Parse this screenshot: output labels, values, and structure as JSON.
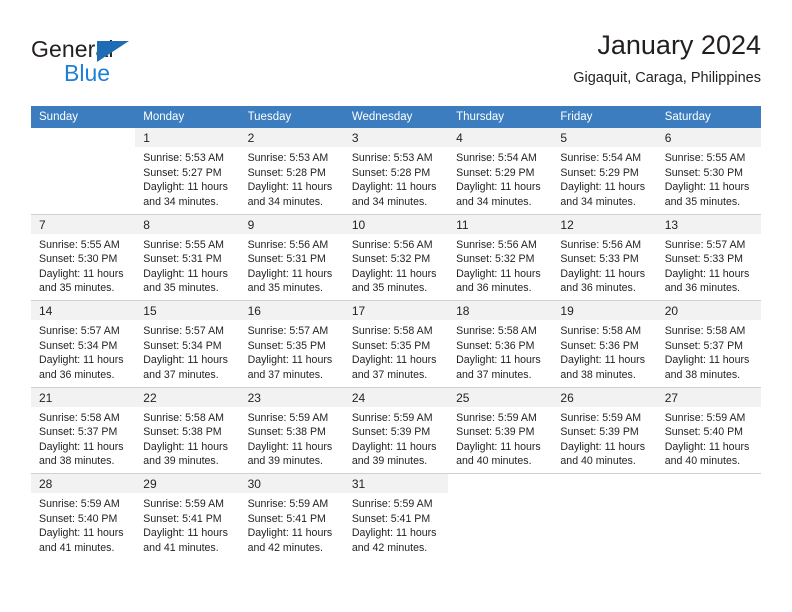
{
  "brand": {
    "name_part1": "General",
    "name_part2": "Blue",
    "triangle_color": "#1e6cb5",
    "blue_color": "#1e7fd4"
  },
  "header": {
    "title": "January 2024",
    "subtitle": "Gigaquit, Caraga, Philippines"
  },
  "theme": {
    "header_row_bg": "#3b7dbf",
    "daynum_bg": "#f2f2f2",
    "text_color": "#231f20",
    "grid_line": "#d9d9d9"
  },
  "weekdays": [
    "Sunday",
    "Monday",
    "Tuesday",
    "Wednesday",
    "Thursday",
    "Friday",
    "Saturday"
  ],
  "weeks": [
    [
      {
        "day": "",
        "sunrise": "",
        "sunset": "",
        "daylight1": "",
        "daylight2": ""
      },
      {
        "day": "1",
        "sunrise": "Sunrise: 5:53 AM",
        "sunset": "Sunset: 5:27 PM",
        "daylight1": "Daylight: 11 hours",
        "daylight2": "and 34 minutes."
      },
      {
        "day": "2",
        "sunrise": "Sunrise: 5:53 AM",
        "sunset": "Sunset: 5:28 PM",
        "daylight1": "Daylight: 11 hours",
        "daylight2": "and 34 minutes."
      },
      {
        "day": "3",
        "sunrise": "Sunrise: 5:53 AM",
        "sunset": "Sunset: 5:28 PM",
        "daylight1": "Daylight: 11 hours",
        "daylight2": "and 34 minutes."
      },
      {
        "day": "4",
        "sunrise": "Sunrise: 5:54 AM",
        "sunset": "Sunset: 5:29 PM",
        "daylight1": "Daylight: 11 hours",
        "daylight2": "and 34 minutes."
      },
      {
        "day": "5",
        "sunrise": "Sunrise: 5:54 AM",
        "sunset": "Sunset: 5:29 PM",
        "daylight1": "Daylight: 11 hours",
        "daylight2": "and 34 minutes."
      },
      {
        "day": "6",
        "sunrise": "Sunrise: 5:55 AM",
        "sunset": "Sunset: 5:30 PM",
        "daylight1": "Daylight: 11 hours",
        "daylight2": "and 35 minutes."
      }
    ],
    [
      {
        "day": "7",
        "sunrise": "Sunrise: 5:55 AM",
        "sunset": "Sunset: 5:30 PM",
        "daylight1": "Daylight: 11 hours",
        "daylight2": "and 35 minutes."
      },
      {
        "day": "8",
        "sunrise": "Sunrise: 5:55 AM",
        "sunset": "Sunset: 5:31 PM",
        "daylight1": "Daylight: 11 hours",
        "daylight2": "and 35 minutes."
      },
      {
        "day": "9",
        "sunrise": "Sunrise: 5:56 AM",
        "sunset": "Sunset: 5:31 PM",
        "daylight1": "Daylight: 11 hours",
        "daylight2": "and 35 minutes."
      },
      {
        "day": "10",
        "sunrise": "Sunrise: 5:56 AM",
        "sunset": "Sunset: 5:32 PM",
        "daylight1": "Daylight: 11 hours",
        "daylight2": "and 35 minutes."
      },
      {
        "day": "11",
        "sunrise": "Sunrise: 5:56 AM",
        "sunset": "Sunset: 5:32 PM",
        "daylight1": "Daylight: 11 hours",
        "daylight2": "and 36 minutes."
      },
      {
        "day": "12",
        "sunrise": "Sunrise: 5:56 AM",
        "sunset": "Sunset: 5:33 PM",
        "daylight1": "Daylight: 11 hours",
        "daylight2": "and 36 minutes."
      },
      {
        "day": "13",
        "sunrise": "Sunrise: 5:57 AM",
        "sunset": "Sunset: 5:33 PM",
        "daylight1": "Daylight: 11 hours",
        "daylight2": "and 36 minutes."
      }
    ],
    [
      {
        "day": "14",
        "sunrise": "Sunrise: 5:57 AM",
        "sunset": "Sunset: 5:34 PM",
        "daylight1": "Daylight: 11 hours",
        "daylight2": "and 36 minutes."
      },
      {
        "day": "15",
        "sunrise": "Sunrise: 5:57 AM",
        "sunset": "Sunset: 5:34 PM",
        "daylight1": "Daylight: 11 hours",
        "daylight2": "and 37 minutes."
      },
      {
        "day": "16",
        "sunrise": "Sunrise: 5:57 AM",
        "sunset": "Sunset: 5:35 PM",
        "daylight1": "Daylight: 11 hours",
        "daylight2": "and 37 minutes."
      },
      {
        "day": "17",
        "sunrise": "Sunrise: 5:58 AM",
        "sunset": "Sunset: 5:35 PM",
        "daylight1": "Daylight: 11 hours",
        "daylight2": "and 37 minutes."
      },
      {
        "day": "18",
        "sunrise": "Sunrise: 5:58 AM",
        "sunset": "Sunset: 5:36 PM",
        "daylight1": "Daylight: 11 hours",
        "daylight2": "and 37 minutes."
      },
      {
        "day": "19",
        "sunrise": "Sunrise: 5:58 AM",
        "sunset": "Sunset: 5:36 PM",
        "daylight1": "Daylight: 11 hours",
        "daylight2": "and 38 minutes."
      },
      {
        "day": "20",
        "sunrise": "Sunrise: 5:58 AM",
        "sunset": "Sunset: 5:37 PM",
        "daylight1": "Daylight: 11 hours",
        "daylight2": "and 38 minutes."
      }
    ],
    [
      {
        "day": "21",
        "sunrise": "Sunrise: 5:58 AM",
        "sunset": "Sunset: 5:37 PM",
        "daylight1": "Daylight: 11 hours",
        "daylight2": "and 38 minutes."
      },
      {
        "day": "22",
        "sunrise": "Sunrise: 5:58 AM",
        "sunset": "Sunset: 5:38 PM",
        "daylight1": "Daylight: 11 hours",
        "daylight2": "and 39 minutes."
      },
      {
        "day": "23",
        "sunrise": "Sunrise: 5:59 AM",
        "sunset": "Sunset: 5:38 PM",
        "daylight1": "Daylight: 11 hours",
        "daylight2": "and 39 minutes."
      },
      {
        "day": "24",
        "sunrise": "Sunrise: 5:59 AM",
        "sunset": "Sunset: 5:39 PM",
        "daylight1": "Daylight: 11 hours",
        "daylight2": "and 39 minutes."
      },
      {
        "day": "25",
        "sunrise": "Sunrise: 5:59 AM",
        "sunset": "Sunset: 5:39 PM",
        "daylight1": "Daylight: 11 hours",
        "daylight2": "and 40 minutes."
      },
      {
        "day": "26",
        "sunrise": "Sunrise: 5:59 AM",
        "sunset": "Sunset: 5:39 PM",
        "daylight1": "Daylight: 11 hours",
        "daylight2": "and 40 minutes."
      },
      {
        "day": "27",
        "sunrise": "Sunrise: 5:59 AM",
        "sunset": "Sunset: 5:40 PM",
        "daylight1": "Daylight: 11 hours",
        "daylight2": "and 40 minutes."
      }
    ],
    [
      {
        "day": "28",
        "sunrise": "Sunrise: 5:59 AM",
        "sunset": "Sunset: 5:40 PM",
        "daylight1": "Daylight: 11 hours",
        "daylight2": "and 41 minutes."
      },
      {
        "day": "29",
        "sunrise": "Sunrise: 5:59 AM",
        "sunset": "Sunset: 5:41 PM",
        "daylight1": "Daylight: 11 hours",
        "daylight2": "and 41 minutes."
      },
      {
        "day": "30",
        "sunrise": "Sunrise: 5:59 AM",
        "sunset": "Sunset: 5:41 PM",
        "daylight1": "Daylight: 11 hours",
        "daylight2": "and 42 minutes."
      },
      {
        "day": "31",
        "sunrise": "Sunrise: 5:59 AM",
        "sunset": "Sunset: 5:41 PM",
        "daylight1": "Daylight: 11 hours",
        "daylight2": "and 42 minutes."
      },
      {
        "day": "",
        "sunrise": "",
        "sunset": "",
        "daylight1": "",
        "daylight2": ""
      },
      {
        "day": "",
        "sunrise": "",
        "sunset": "",
        "daylight1": "",
        "daylight2": ""
      },
      {
        "day": "",
        "sunrise": "",
        "sunset": "",
        "daylight1": "",
        "daylight2": ""
      }
    ]
  ]
}
